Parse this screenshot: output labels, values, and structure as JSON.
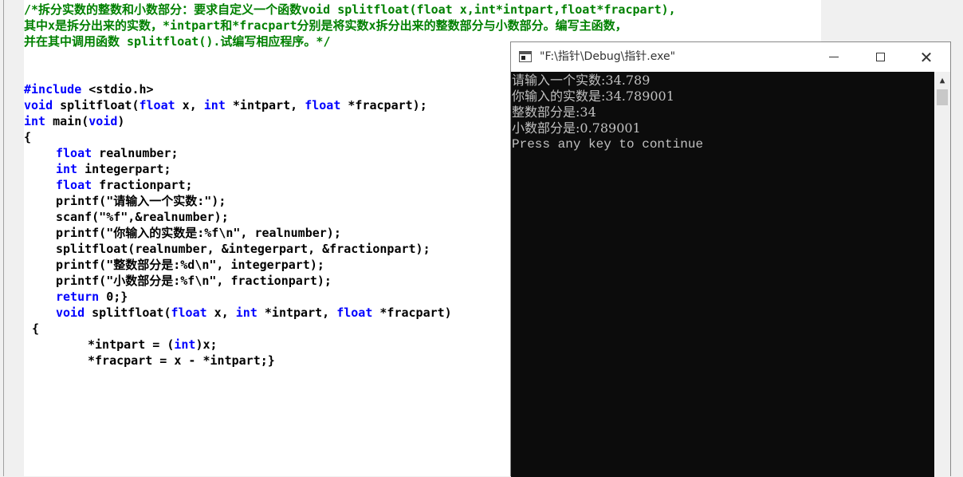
{
  "editor": {
    "lines": [
      {
        "parts": [
          {
            "t": "/*拆分实数的整数和小数部分：要求自定义一个函数void splitfloat(float x,int*intpart,float*fracpart),",
            "c": "cm"
          }
        ]
      },
      {
        "parts": [
          {
            "t": "其中x是拆分出来的实数，*intpart和*fracpart分别是将实数x拆分出来的整数部分与小数部分。编写主函数，",
            "c": "cm"
          }
        ]
      },
      {
        "parts": [
          {
            "t": "并在其中调用函数 splitfloat().试编写相应程序。*/",
            "c": "cm"
          }
        ]
      },
      {
        "parts": [
          {
            "t": "#include ",
            "c": "kw"
          },
          {
            "t": "<stdio.h>",
            "c": ""
          }
        ]
      },
      {
        "parts": [
          {
            "t": "void",
            "c": "kw"
          },
          {
            "t": " splitfloat(",
            "c": ""
          },
          {
            "t": "float",
            "c": "kw"
          },
          {
            "t": " x, ",
            "c": ""
          },
          {
            "t": "int",
            "c": "kw"
          },
          {
            "t": " *intpart, ",
            "c": ""
          },
          {
            "t": "float",
            "c": "kw"
          },
          {
            "t": " *fracpart);",
            "c": ""
          }
        ]
      },
      {
        "parts": [
          {
            "t": "int",
            "c": "kw"
          },
          {
            "t": " main(",
            "c": ""
          },
          {
            "t": "void",
            "c": "kw"
          },
          {
            "t": ")",
            "c": ""
          }
        ]
      },
      {
        "parts": [
          {
            "t": "{",
            "c": ""
          }
        ]
      },
      {
        "parts": [
          {
            "t": "float",
            "c": "kw"
          },
          {
            "t": " realnumber;",
            "c": ""
          }
        ]
      },
      {
        "parts": [
          {
            "t": "int",
            "c": "kw"
          },
          {
            "t": " integerpart;",
            "c": ""
          }
        ]
      },
      {
        "parts": [
          {
            "t": "float",
            "c": "kw"
          },
          {
            "t": " fractionpart;",
            "c": ""
          }
        ]
      },
      {
        "parts": [
          {
            "t": "printf(\"请输入一个实数:\");",
            "c": ""
          }
        ]
      },
      {
        "parts": [
          {
            "t": "scanf(\"%f\",&realnumber);",
            "c": ""
          }
        ]
      },
      {
        "parts": [
          {
            "t": "printf(\"你输入的实数是:%f\\n\", realnumber);",
            "c": ""
          }
        ]
      },
      {
        "parts": [
          {
            "t": "splitfloat(realnumber, &integerpart, &fractionpart);",
            "c": ""
          }
        ]
      },
      {
        "parts": [
          {
            "t": "printf(\"整数部分是:%d\\n\", integerpart);",
            "c": ""
          }
        ]
      },
      {
        "parts": [
          {
            "t": "printf(\"小数部分是:%f\\n\", fractionpart);",
            "c": ""
          }
        ]
      },
      {
        "parts": [
          {
            "t": "return",
            "c": "kw"
          },
          {
            "t": " 0;}",
            "c": ""
          }
        ]
      },
      {
        "parts": [
          {
            "t": "void",
            "c": "kw"
          },
          {
            "t": " splitfloat(",
            "c": ""
          },
          {
            "t": "float",
            "c": "kw"
          },
          {
            "t": " x, ",
            "c": ""
          },
          {
            "t": "int",
            "c": "kw"
          },
          {
            "t": " *intpart, ",
            "c": ""
          },
          {
            "t": "float",
            "c": "kw"
          },
          {
            "t": " *fracpart)",
            "c": ""
          }
        ]
      },
      {
        "parts": [
          {
            "t": "{",
            "c": ""
          }
        ]
      },
      {
        "parts": [
          {
            "t": "*intpart = (",
            "c": ""
          },
          {
            "t": "int",
            "c": "kw"
          },
          {
            "t": ")x;",
            "c": ""
          }
        ]
      },
      {
        "parts": [
          {
            "t": "*fracpart = x - *intpart;}",
            "c": ""
          }
        ]
      }
    ]
  },
  "console": {
    "title": "\"F:\\指针\\Debug\\指针.exe\"",
    "minimize_icon": "minimize-icon",
    "maximize_icon": "maximize-icon",
    "close_icon": "close-icon",
    "output": [
      "请输入一个实数:34.789",
      "你输入的实数是:34.789001",
      "整数部分是:34",
      "小数部分是:0.789001",
      "Press any key to continue"
    ]
  }
}
